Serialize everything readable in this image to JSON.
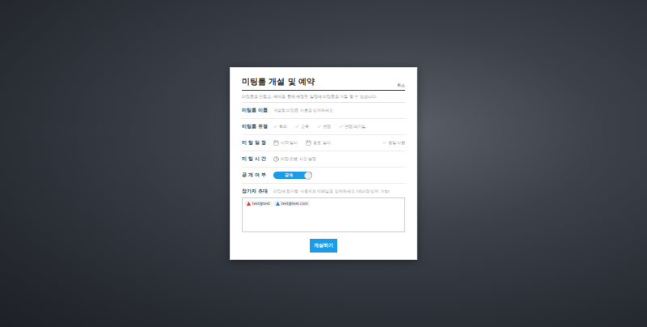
{
  "dialog": {
    "title": "미팅룸 개설 및 예약",
    "close": "취소",
    "description": "미팅룸을 만들고, 예약을 통해 예정된 일정에 미팅룸을 가질 할 수 있습니다."
  },
  "fields": [
    {
      "kind": "text",
      "label": "미팅룸 이름",
      "placeholder": "개설할 미팅룸 이름을 입력하세요"
    },
    {
      "kind": "checks",
      "label": "미팅룸 유형",
      "options": [
        {
          "label": "회의",
          "checked": false
        },
        {
          "label": "교육",
          "checked": false
        },
        {
          "label": "면접",
          "checked": false
        },
        {
          "label": "면접 대기실",
          "checked": false
        }
      ]
    },
    {
      "kind": "schedule",
      "label": "미 팅 일 정",
      "start": "시작 일시",
      "end": "종료 일시",
      "allday": {
        "label": "종일 시행",
        "checked": false
      }
    },
    {
      "kind": "time",
      "label": "미 팅 시 간",
      "placeholder": "미팅 진행 시간 설정"
    },
    {
      "kind": "toggle",
      "label": "공 개 여 부",
      "text": "공개",
      "on": true
    }
  ],
  "invite": {
    "label": "참가자 초대",
    "hint": "미팅에 참가할 사용자의 이메일을 입력하세요 (여러명 입력 가능)",
    "tags": [
      {
        "email": "test@test",
        "color": "#e53935"
      },
      {
        "email": "test@test.com",
        "color": "#1e88e5"
      }
    ]
  },
  "submit": "개설하기"
}
